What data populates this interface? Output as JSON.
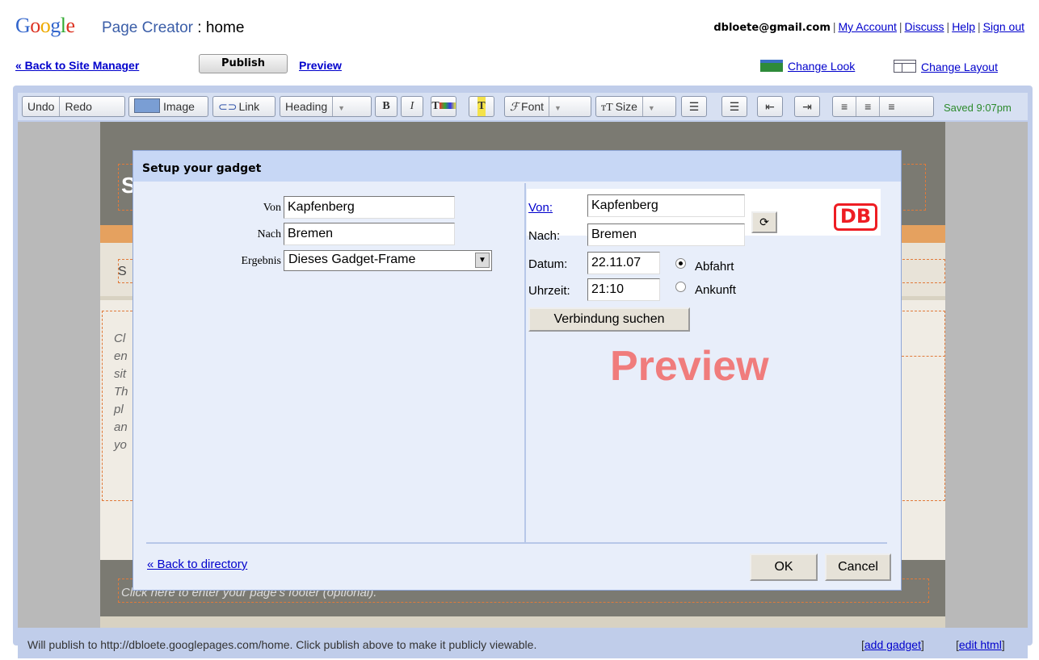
{
  "header": {
    "logo": "Google",
    "app_name": "Page Creator",
    "page_name": ": home",
    "email": "dbloete@gmail.com",
    "links": [
      "My Account",
      "Discuss",
      "Help",
      "Sign out"
    ],
    "back_to_site": "« Back to Site Manager",
    "publish": "Publish",
    "preview": "Preview",
    "change_look": "Change Look",
    "change_layout": "Change Layout"
  },
  "toolbar": {
    "undo": "Undo",
    "redo": "Redo",
    "image": "Image",
    "link": "Link",
    "heading": "Heading",
    "bold": "B",
    "italic": "I",
    "font": "Font",
    "size": "Size",
    "saved": "Saved 9:07pm"
  },
  "page": {
    "title_partial": "S",
    "subtitle_partial": "S",
    "body_partial": [
      "Cl",
      "en",
      "sit",
      "Th",
      "pl",
      "an",
      "yo"
    ],
    "footer_placeholder": "Click here to enter your page's footer (optional)."
  },
  "dialog": {
    "title": "Setup your gadget",
    "settings": {
      "von_label": "Von",
      "von_value": "Kapfenberg",
      "nach_label": "Nach",
      "nach_value": "Bremen",
      "ergebnis_label": "Ergebnis",
      "ergebnis_value": "Dieses Gadget-Frame"
    },
    "preview": {
      "von_label": "Von:",
      "von_value": "Kapfenberg",
      "nach_label": "Nach:",
      "nach_value": "Bremen",
      "datum_label": "Datum:",
      "datum_value": "22.11.07",
      "uhrzeit_label": "Uhrzeit:",
      "uhrzeit_value": "21:10",
      "abfahrt": "Abfahrt",
      "ankunft": "Ankunft",
      "search_button": "Verbindung suchen",
      "logo": "DB",
      "watermark": "Preview"
    },
    "back_to_directory": "« Back to directory",
    "ok": "OK",
    "cancel": "Cancel"
  },
  "status": {
    "text": "Will publish to http://dbloete.googlepages.com/home. Click publish above to make it publicly viewable.",
    "add_gadget": "add gadget",
    "edit_html": "edit html"
  }
}
